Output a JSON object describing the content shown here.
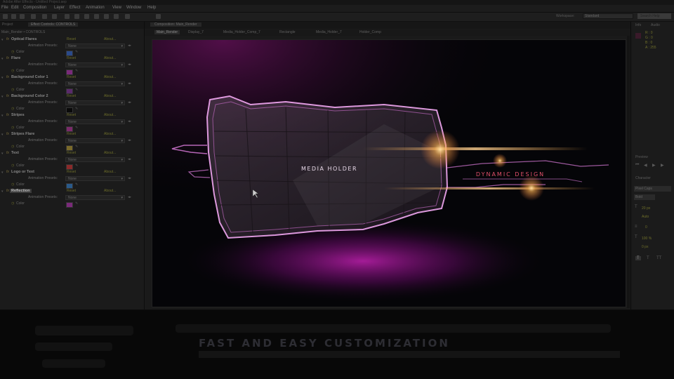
{
  "window": {
    "title": "Adobe After Effects - Untitled Project.aep"
  },
  "menu": [
    "File",
    "Edit",
    "Composition",
    "Layer",
    "Effect",
    "Animation",
    "View",
    "Window",
    "Help"
  ],
  "toolbar": {
    "workspace_label": "Workspace:",
    "workspace_value": "Standard",
    "search_placeholder": "Search Help"
  },
  "left_panel": {
    "tabs": [
      "Project",
      "Effect Controls: CONTROLS"
    ],
    "breadcrumb": "Main_Render • CONTROLS",
    "groups": [
      {
        "name": "Optical Flares",
        "reset": "Reset",
        "about": "About...",
        "preset_label": "Animation Presets:",
        "preset_value": "None",
        "color_label": "Color",
        "color": "#2a4a8a"
      },
      {
        "name": "Flare",
        "reset": "Reset",
        "about": "About...",
        "preset_label": "Animation Presets:",
        "preset_value": "None",
        "color_label": "Color",
        "color": "#7a2a7a"
      },
      {
        "name": "Background Color 1",
        "reset": "Reset",
        "about": "About...",
        "preset_label": "Animation Presets:",
        "preset_value": "None",
        "color_label": "Color",
        "color": "#5a2a6a"
      },
      {
        "name": "Background Color 2",
        "reset": "Reset",
        "about": "About...",
        "preset_label": "Animation Presets:",
        "preset_value": "None",
        "color_label": "Color",
        "color": "#0a0a0a"
      },
      {
        "name": "Stripes",
        "reset": "Reset",
        "about": "About...",
        "preset_label": "Animation Presets:",
        "preset_value": "None",
        "color_label": "Color",
        "color": "#7a2a6a"
      },
      {
        "name": "Stripes Flare",
        "reset": "Reset",
        "about": "About...",
        "preset_label": "Animation Presets:",
        "preset_value": "None",
        "color_label": "Color",
        "color": "#7a6a2a"
      },
      {
        "name": "Text",
        "reset": "Reset",
        "about": "About...",
        "preset_label": "Animation Presets:",
        "preset_value": "None",
        "color_label": "Color",
        "color": "#8a2a2a"
      },
      {
        "name": "Logo or Text",
        "reset": "Reset",
        "about": "About...",
        "preset_label": "Animation Presets:",
        "preset_value": "None",
        "color_label": "Color",
        "color": "#2a5a8a"
      },
      {
        "name": "Reflection",
        "reset": "Reset",
        "about": "About...",
        "preset_label": "Animation Presets:",
        "preset_value": "None",
        "color_label": "Color",
        "color": "#7a2a7a"
      }
    ]
  },
  "comp_panel": {
    "tab": "Composition: Main_Render",
    "breadcrumbs": [
      "Main_Render",
      "Display_7",
      "Media_Holder_Comp_7",
      "Rectangle",
      "Media_Holder_7",
      "Holder_Comp"
    ],
    "viewer": {
      "media_holder_text": "MEDIA HOLDER",
      "dynamic_text": "DYNAMIC DESIGN"
    }
  },
  "right_panel": {
    "info_tab": "Info",
    "audio_tab": "Audio",
    "info_values": [
      "R : 0",
      "G : 0",
      "B : 0",
      "A : 255"
    ],
    "preview_tab": "Preview",
    "character_tab": "Character",
    "font_name": "Pixel Caps",
    "font_style": "Bold",
    "size": "20 px",
    "leading": "Auto",
    "tracking": "0",
    "scale": "100 %",
    "baseline": "0 px"
  },
  "overlay": {
    "tagline": "FAST AND EASY CUSTOMIZATION"
  },
  "colors": {
    "accent_pink": "#ff3cc8",
    "frame_glow": "#ffb0ff",
    "flare_orange": "#ffb050",
    "dynamic_text": "#e0506a"
  }
}
